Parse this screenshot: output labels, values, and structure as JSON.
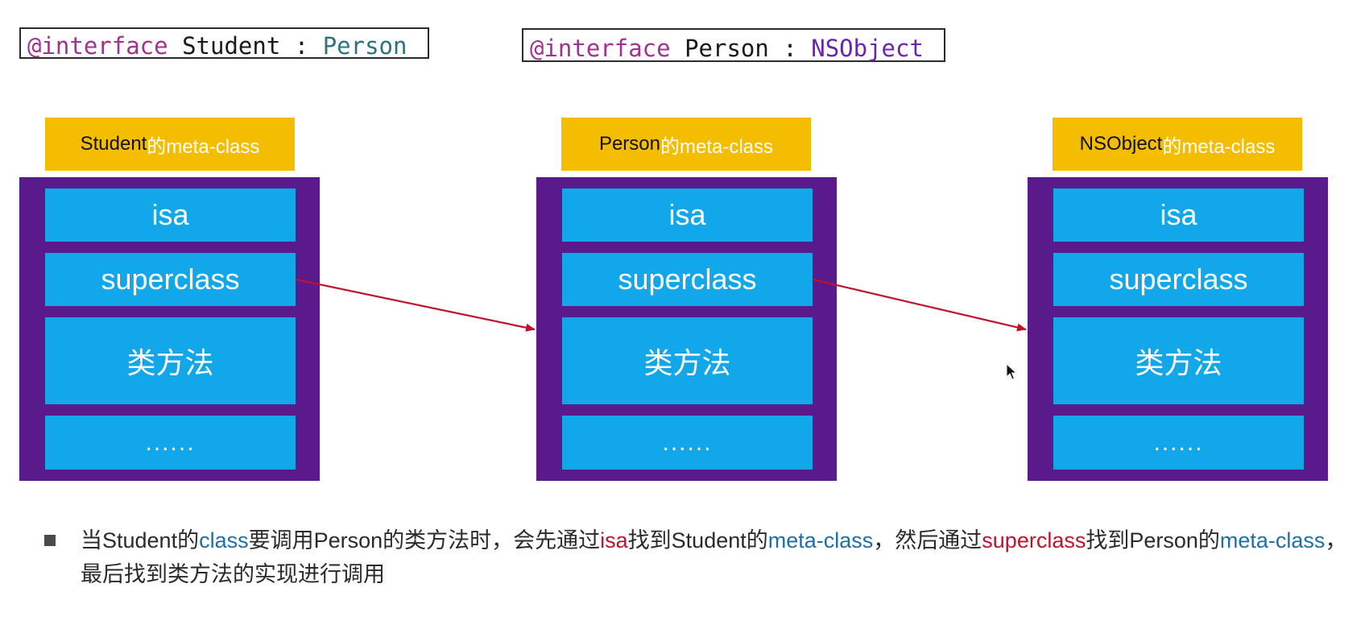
{
  "code": {
    "student": {
      "keyword": "@interface",
      "name": "Student",
      "sep": ":",
      "parent": "Person"
    },
    "person": {
      "keyword": "@interface",
      "name": "Person",
      "sep": ":",
      "parent": "NSObject"
    }
  },
  "columns": [
    {
      "label_prefix": "Student",
      "label_suffix": "的meta-class",
      "isa": "isa",
      "superclass": "superclass",
      "methods": "类方法",
      "more": "......"
    },
    {
      "label_prefix": "Person",
      "label_suffix": "的meta-class",
      "isa": "isa",
      "superclass": "superclass",
      "methods": "类方法",
      "more": "......"
    },
    {
      "label_prefix": "NSObject",
      "label_suffix": "的meta-class",
      "isa": "isa",
      "superclass": "superclass",
      "methods": "类方法",
      "more": "......"
    }
  ],
  "caption": {
    "p1": "当Student的",
    "w_class": "class",
    "p2": "要调用Person的类方法时，会先通过",
    "w_isa": "isa",
    "p3": "找到Student的",
    "w_meta1": "meta-class",
    "p4": "，然后通过",
    "w_super": "superclass",
    "p5": "找到Person的",
    "w_meta2": "meta-class",
    "p6": "，最后找到类方法的实现进行调用"
  },
  "colors": {
    "label_bg": "#f5bd00",
    "frame": "#5a1a8c",
    "cell": "#12a7e8",
    "arrow": "#c0122c"
  },
  "icons": {
    "cursor": "mouse-pointer-icon",
    "bullet": "square-bullet-icon"
  }
}
